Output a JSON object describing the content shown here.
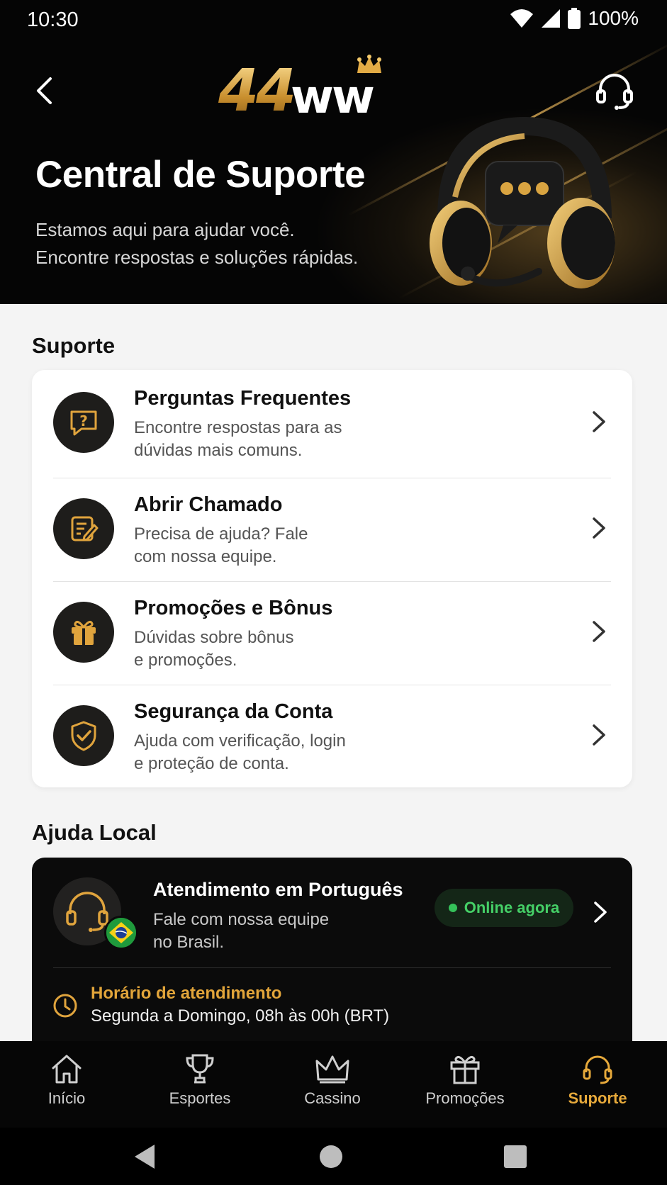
{
  "status_bar": {
    "time": "10:30",
    "battery": "100%"
  },
  "header": {
    "logo_number": "44",
    "logo_letters": "ww",
    "title": "Central de Suporte",
    "subtitle_line1": "Estamos aqui para ajudar você.",
    "subtitle_line2": "Encontre respostas e soluções rápidas."
  },
  "support": {
    "section_title": "Suporte",
    "items": [
      {
        "title": "Perguntas Frequentes",
        "desc_line1": "Encontre respostas para as",
        "desc_line2": "dúvidas mais comuns.",
        "icon": "faq-icon"
      },
      {
        "title": "Abrir Chamado",
        "desc_line1": "Precisa de ajuda? Fale",
        "desc_line2": "com nossa equipe.",
        "icon": "ticket-icon"
      },
      {
        "title": "Promoções e Bônus",
        "desc_line1": "Dúvidas sobre bônus",
        "desc_line2": "e promoções.",
        "icon": "gift-icon"
      },
      {
        "title": "Segurança da Conta",
        "desc_line1": "Ajuda com verificação, login",
        "desc_line2": "e proteção de conta.",
        "icon": "shield-icon"
      }
    ]
  },
  "local_help": {
    "section_title": "Ajuda Local",
    "title": "Atendimento em Português",
    "desc_line1": "Fale com nossa equipe",
    "desc_line2": "no Brasil.",
    "badge": "Online agora",
    "hours_title": "Horário de atendimento",
    "hours_text": "Segunda a Domingo, 08h às 00h (BRT)"
  },
  "bottom_nav": {
    "items": [
      {
        "label": "Início",
        "icon": "home-icon",
        "active": false
      },
      {
        "label": "Esportes",
        "icon": "trophy-icon",
        "active": false
      },
      {
        "label": "Cassino",
        "icon": "crown-icon",
        "active": false
      },
      {
        "label": "Promoções",
        "icon": "gift-icon",
        "active": false
      },
      {
        "label": "Suporte",
        "icon": "headset-icon",
        "active": true
      }
    ]
  },
  "colors": {
    "accent": "#e6a93b",
    "gold": "#d9a441",
    "online": "#35c25a",
    "dark": "#050505"
  }
}
